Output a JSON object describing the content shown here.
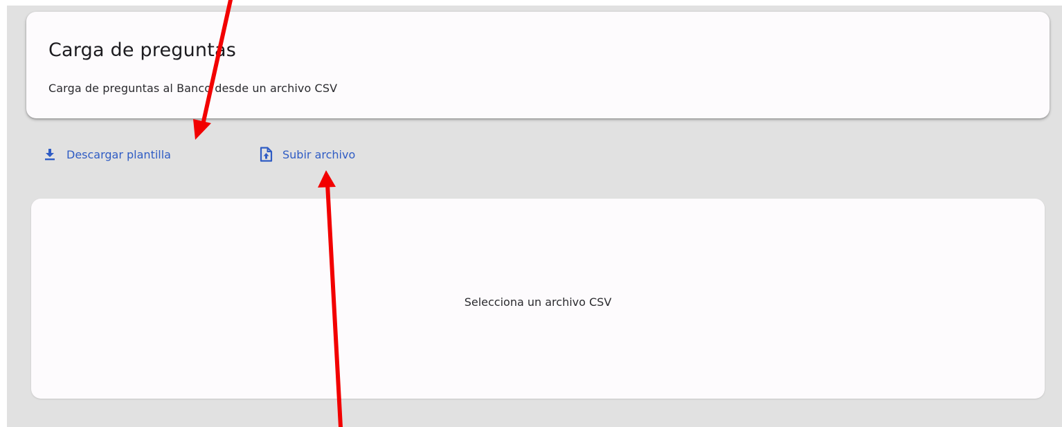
{
  "header": {
    "title": "Carga de preguntas",
    "subtitle": "Carga de preguntas al Banco desde un archivo CSV"
  },
  "actions": {
    "download": {
      "label": "Descargar plantilla",
      "icon": "download-icon"
    },
    "upload": {
      "label": "Subir archivo",
      "icon": "file-upload-icon"
    }
  },
  "drop_area": {
    "message": "Selecciona un archivo CSV"
  },
  "annotations": {
    "arrow_color": "#f20000"
  },
  "colors": {
    "accent": "#2f5cc4",
    "background": "#e1e1e1",
    "card": "#fdfbfd"
  }
}
